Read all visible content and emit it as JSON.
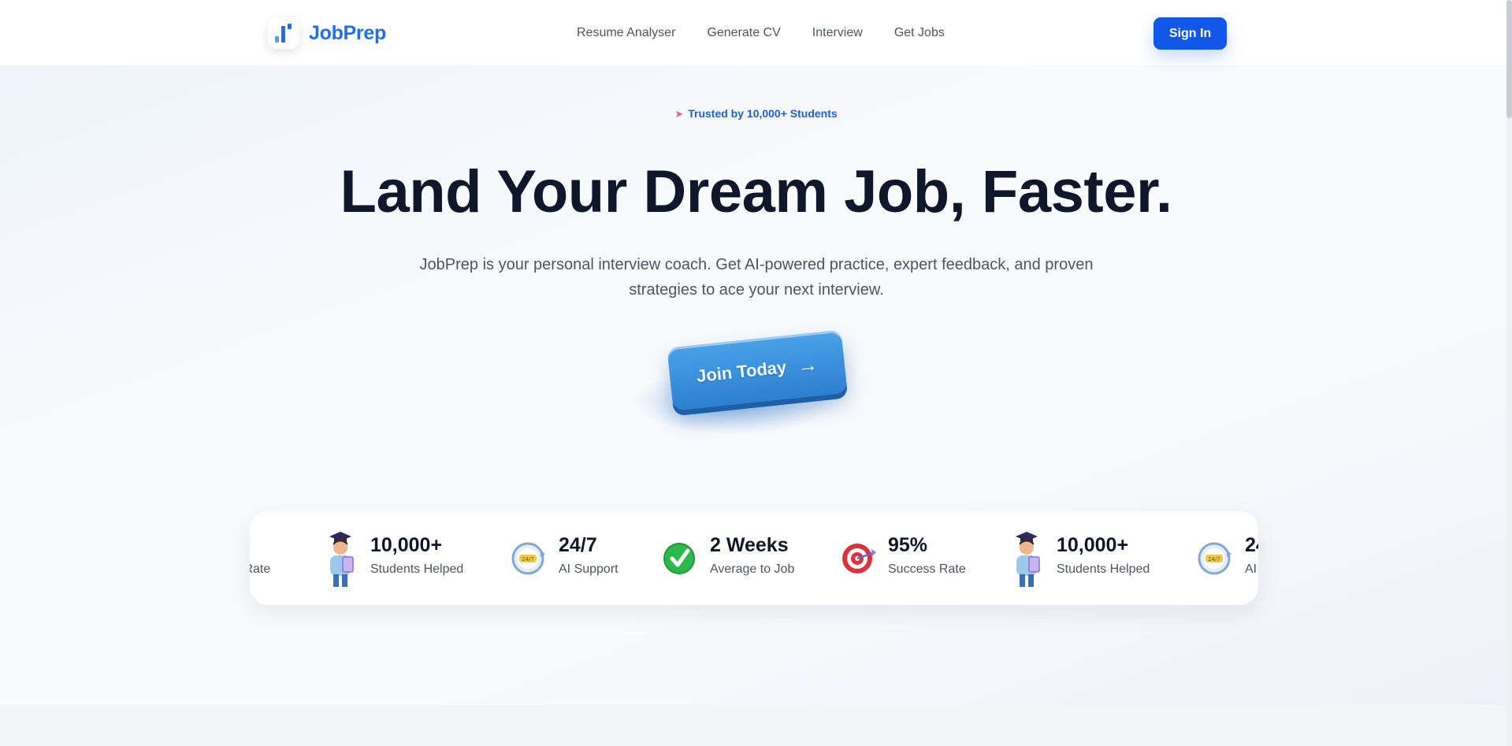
{
  "brand": {
    "name": "JobPrep",
    "logo_icon": "bar-chart-logo",
    "accent_color": "#1d6ff2"
  },
  "nav": {
    "links": [
      {
        "label": "Resume Analyser"
      },
      {
        "label": "Generate CV"
      },
      {
        "label": "Interview"
      },
      {
        "label": "Get Jobs"
      }
    ],
    "signin_label": "Sign In",
    "signin_color": "#1157e8"
  },
  "hero": {
    "badge_icon": "rocket-icon",
    "badge_text": "Trusted by 10,000+ Students",
    "headline": "Land Your Dream Job, Faster.",
    "subtitle": "JobPrep is your personal interview coach. Get AI-powered practice, expert feedback, and proven strategies to ace your next interview.",
    "cta_label": "Join Today",
    "cta_icon": "arrow-right-icon"
  },
  "stats": {
    "items": [
      {
        "value": "10,000+",
        "label": "Students Helped",
        "icon": "graduate-icon"
      },
      {
        "value": "24/7",
        "label": "AI Support",
        "icon": "clock-badge-icon"
      },
      {
        "value": "2 Weeks",
        "label": "Average to Job",
        "icon": "checkmark-icon"
      },
      {
        "value": "95%",
        "label": "Success Rate",
        "icon": "target-icon"
      }
    ],
    "partial_left": {
      "label": "s Rate"
    },
    "partial_right": {
      "value": "24",
      "label": "AI"
    }
  }
}
